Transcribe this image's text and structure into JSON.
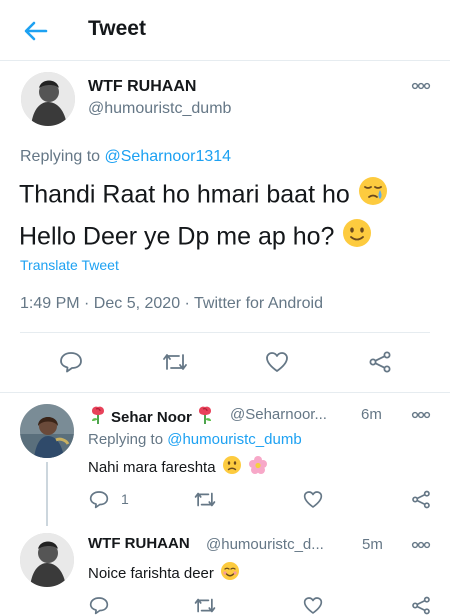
{
  "header": {
    "title": "Tweet"
  },
  "main_tweet": {
    "author_name": "WTF RUHAAN",
    "author_handle": "@humouristc_dumb",
    "replying_label": "Replying to ",
    "replying_to": "@Seharnoor1314",
    "text_line1": "Thandi Raat ho hmari baat ho",
    "text_line2": "Hello Deer ye Dp me ap ho?",
    "translate_label": "Translate Tweet",
    "meta": "1:49 PM · Dec 5, 2020 · Twitter for Android"
  },
  "replies": [
    {
      "author_name": "Sehar Noor",
      "author_handle": "@Seharnoor...",
      "time": "6m",
      "replying_label": "Replying to ",
      "replying_to": "@humouristc_dumb",
      "text": "Nahi mara fareshta",
      "reply_count": "1"
    },
    {
      "author_name": "WTF RUHAAN",
      "author_handle": "@humouristc_d...",
      "time": "5m",
      "text": "Noice farishta deer"
    }
  ],
  "icons": [
    "back-arrow-icon",
    "more-icon",
    "reply-icon",
    "retweet-icon",
    "like-icon",
    "share-icon",
    "rose-icon",
    "crying-face-icon",
    "smile-face-icon",
    "frown-face-icon",
    "blossom-icon",
    "smiling-face-icon"
  ],
  "colors": {
    "accent": "#1da1f2",
    "secondary_text": "#657786",
    "divider": "#e6ecf0"
  }
}
